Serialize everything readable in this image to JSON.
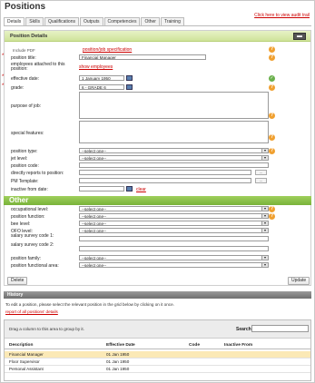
{
  "page": {
    "title": "Positions",
    "audit_link": "Click here to view audit trail"
  },
  "tabs": [
    "Details",
    "Skills",
    "Qualifications",
    "Outputs",
    "Competencies",
    "Other",
    "Training"
  ],
  "panel": {
    "header": "Position Details"
  },
  "form": {
    "pdf_label": "Include PDF",
    "jobspec_link": "position/job specification",
    "position_title_label": "position title:",
    "position_title_value": "Financial Manager",
    "employees_label": "employees attached to this position:",
    "show_employees_link": "show employees",
    "effective_date_label": "effective date:",
    "effective_date_value": "1 January   1950",
    "grade_label": "grade:",
    "grade_value": "6 - GRADE 6",
    "purpose_label": "purpose of job:",
    "special_label": "special features:",
    "position_type_label": "position type:",
    "select_one": "--select one--",
    "jet_level_label": "jet level:",
    "position_code_label": "position code:",
    "directly_reports_label": "directly reports to position:",
    "pm_template_label": "PM Template:",
    "inactive_from_label": "inactive from date:",
    "clear_link": "clear"
  },
  "other_section": {
    "title": "Other",
    "fields": [
      "occupational level:",
      "position function:",
      "bee level:",
      "OFO level:",
      "salary survey code 1:",
      "salary survey code 2:",
      "position family:",
      "position functional area:"
    ]
  },
  "buttons": {
    "delete": "Delete",
    "update": "Update"
  },
  "history": {
    "title": "History",
    "note": "To edit a position, please select the relevant position in the grid below by clicking on it once.",
    "report_link": "report of all positions' details",
    "drag_hint": "Drag a column to this area to group by it.",
    "search_label": "Search:",
    "columns": [
      "Description",
      "Effective Date",
      "Code",
      "Inactive From"
    ],
    "rows": [
      [
        "Financial Manager",
        "01 Jan 1950",
        "",
        ""
      ],
      [
        "Floor Supervisor",
        "01 Jan 1950",
        "",
        ""
      ],
      [
        "Personal Assistant",
        "01 Jan 1950",
        "",
        ""
      ]
    ]
  }
}
